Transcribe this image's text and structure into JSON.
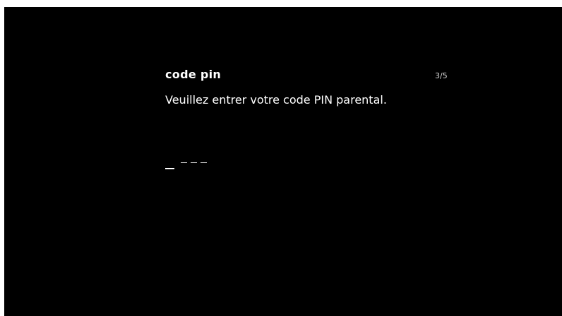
{
  "dialog": {
    "title": "code pin",
    "step": "3/5",
    "message": "Veuillez entrer votre code PIN parental."
  },
  "pin": {
    "length": 4,
    "entered": 0,
    "active_slot": 1
  },
  "colors": {
    "background": "#000000",
    "text": "#ffffff",
    "muted": "#bdbdbd"
  }
}
